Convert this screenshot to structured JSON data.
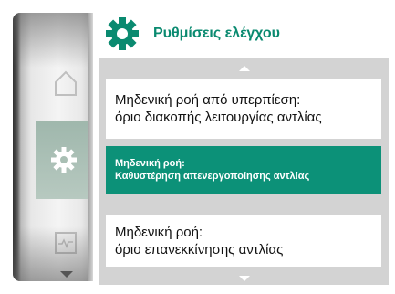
{
  "header": {
    "title": "Ρυθμίσεις ελέγχου",
    "icon": "gear-icon",
    "accent_color": "#0a8a70"
  },
  "navigation": {
    "items": [
      {
        "icon": "home-icon",
        "selected": false
      },
      {
        "icon": "gear-icon",
        "selected": true
      },
      {
        "icon": "diagnostics-icon",
        "selected": false
      }
    ]
  },
  "menu": {
    "items": [
      {
        "line1": "Μηδενική ροή από υπερπίεση:",
        "line2": "όριο διακοπής λειτουργίας αντλίας",
        "selected": false
      },
      {
        "line1": "Μηδενική ροή:",
        "line2": "Καθυστέρηση απενεργοποίησης αντλίας",
        "selected": true
      },
      {
        "line1": "Μηδενική ροή:",
        "line2": "όριο επανεκκίνησης αντλίας",
        "selected": false
      }
    ],
    "selected_color": "#0c9178"
  }
}
